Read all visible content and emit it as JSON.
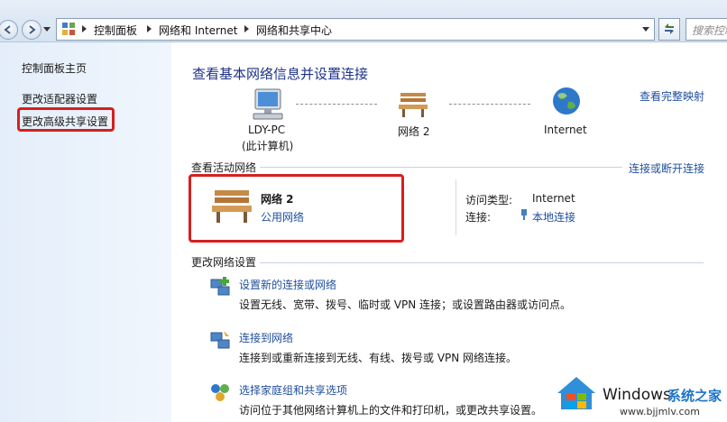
{
  "address_bar": {
    "breadcrumbs": [
      "控制面板",
      "网络和 Internet",
      "网络和共享中心"
    ],
    "search_placeholder": "搜索控制面"
  },
  "sidebar": {
    "home": "控制面板主页",
    "items": [
      "更改适配器设置",
      "更改高级共享设置"
    ]
  },
  "main": {
    "title": "查看基本网络信息并设置连接",
    "view_full_map": "查看完整映射",
    "map": {
      "computer_name": "LDY-PC",
      "computer_note": "(此计算机)",
      "network_name": "网络  2",
      "internet": "Internet"
    },
    "active_networks": {
      "header": "查看活动网络",
      "connect_disconnect": "连接或断开连接",
      "network_name": "网络  2",
      "network_type": "公用网络",
      "access_type_label": "访问类型:",
      "access_type_value": "Internet",
      "connection_label": "连接:",
      "connection_value": "本地连接"
    },
    "change_settings": {
      "header": "更改网络设置",
      "tasks": [
        {
          "title": "设置新的连接或网络",
          "desc": "设置无线、宽带、拨号、临时或 VPN 连接；或设置路由器或访问点。"
        },
        {
          "title": "连接到网络",
          "desc": "连接到或重新连接到无线、有线、拨号或 VPN 网络连接。"
        },
        {
          "title": "选择家庭组和共享选项",
          "desc": "访问位于其他网络计算机上的文件和打印机，或更改共享设置。"
        }
      ]
    }
  },
  "watermark": {
    "brand": "Windows",
    "site_name": "系统之家",
    "url": "www.bjjmlv.com"
  },
  "colors": {
    "link": "#1f4e9e",
    "title": "#1e3287",
    "highlight_border": "#d61f1f",
    "sidebar_bg": "#e4eefa"
  }
}
